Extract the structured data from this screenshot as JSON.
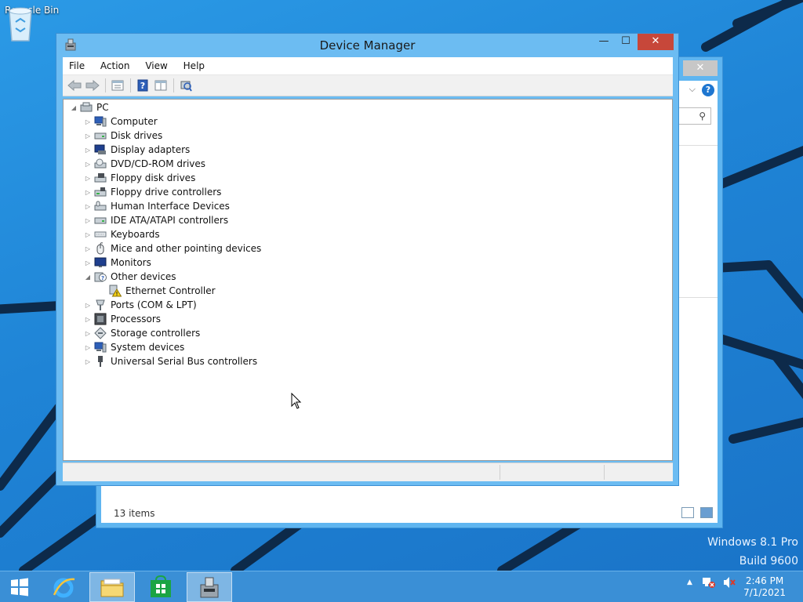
{
  "desktop": {
    "recycle_bin_label": "Recycle Bin",
    "watermark_line1": "Windows 8.1 Pro",
    "watermark_line2": "Build 9600"
  },
  "background_window": {
    "close_glyph": "✕",
    "search_glyph": "⚲",
    "status_items": "13 items"
  },
  "device_manager": {
    "title": "Device Manager",
    "caption": {
      "minimize": "—",
      "maximize": "☐",
      "close": "✕"
    },
    "menu": [
      "File",
      "Action",
      "View",
      "Help"
    ],
    "toolbar_icons": [
      "back-icon",
      "forward-icon",
      "properties-pane-icon",
      "help-icon",
      "show-hide-console-tree-icon",
      "scan-hardware-icon"
    ],
    "tree": {
      "root": "PC",
      "categories": [
        {
          "label": "Computer",
          "icon": "computer-icon",
          "expanded": false
        },
        {
          "label": "Disk drives",
          "icon": "disk-drive-icon",
          "expanded": false
        },
        {
          "label": "Display adapters",
          "icon": "display-adapter-icon",
          "expanded": false
        },
        {
          "label": "DVD/CD-ROM drives",
          "icon": "dvd-drive-icon",
          "expanded": false
        },
        {
          "label": "Floppy disk drives",
          "icon": "floppy-disk-icon",
          "expanded": false
        },
        {
          "label": "Floppy drive controllers",
          "icon": "floppy-controller-icon",
          "expanded": false
        },
        {
          "label": "Human Interface Devices",
          "icon": "hid-icon",
          "expanded": false
        },
        {
          "label": "IDE ATA/ATAPI controllers",
          "icon": "ide-controller-icon",
          "expanded": false
        },
        {
          "label": "Keyboards",
          "icon": "keyboard-icon",
          "expanded": false
        },
        {
          "label": "Mice and other pointing devices",
          "icon": "mouse-icon",
          "expanded": false
        },
        {
          "label": "Monitors",
          "icon": "monitor-icon",
          "expanded": false
        },
        {
          "label": "Other devices",
          "icon": "other-devices-icon",
          "expanded": true
        },
        {
          "label": "Ports (COM & LPT)",
          "icon": "ports-icon",
          "expanded": false
        },
        {
          "label": "Processors",
          "icon": "processor-icon",
          "expanded": false
        },
        {
          "label": "Storage controllers",
          "icon": "storage-controller-icon",
          "expanded": false
        },
        {
          "label": "System devices",
          "icon": "system-devices-icon",
          "expanded": false
        },
        {
          "label": "Universal Serial Bus controllers",
          "icon": "usb-icon",
          "expanded": false
        }
      ],
      "other_devices_child": {
        "label": "Ethernet Controller",
        "icon": "warning-device-icon"
      }
    }
  },
  "taskbar": {
    "apps": [
      "start-icon",
      "internet-explorer-icon",
      "file-explorer-icon",
      "store-icon",
      "device-manager-icon"
    ],
    "active_app": "device-manager-icon",
    "tray_icons": [
      "show-hidden-icons-icon",
      "network-icon",
      "volume-muted-icon"
    ],
    "time": "2:46 PM",
    "date": "7/1/2021"
  },
  "colors": {
    "desktop_blue": "#1f84d6",
    "window_frame": "#6cbcf2",
    "close_red": "#c7473a",
    "taskbar": "#3a8fd6"
  }
}
